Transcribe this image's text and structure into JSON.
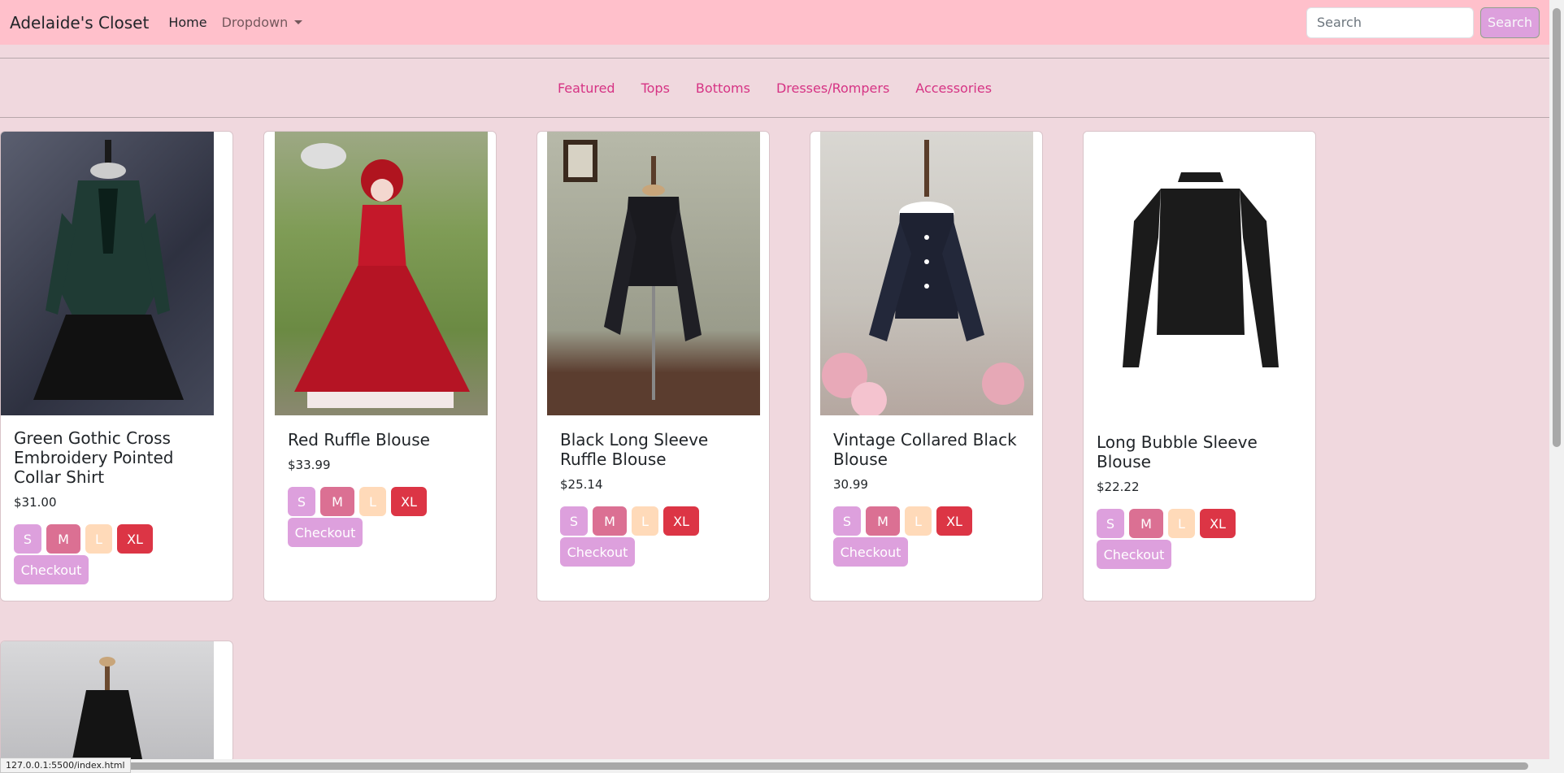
{
  "navbar": {
    "brand": "Adelaide's Closet",
    "home": "Home",
    "dropdown": "Dropdown",
    "search_placeholder": "Search",
    "search_button": "Search"
  },
  "categories": [
    "Featured",
    "Tops",
    "Bottoms",
    "Dresses/Rompers",
    "Accessories"
  ],
  "products": [
    {
      "title": "Green Gothic Cross Embroidery Pointed Collar Shirt",
      "price": "$31.00"
    },
    {
      "title": "Red Ruffle Blouse",
      "price": "$33.99"
    },
    {
      "title": "Black Long Sleeve Ruffle Blouse",
      "price": "$25.14"
    },
    {
      "title": "Vintage Collared Black Blouse",
      "price": "30.99"
    },
    {
      "title": "Long Bubble Sleeve Blouse",
      "price": "$22.22"
    }
  ],
  "sizes": {
    "s": "S",
    "m": "M",
    "l": "L",
    "xl": "XL"
  },
  "checkout_label": "Checkout",
  "status_url": "127.0.0.1:5500/index.html",
  "colors": {
    "navbar_bg": "#ffc0cb",
    "page_bg": "#f0d8de",
    "accent_link": "#d63384",
    "size_s": "#dda0dd",
    "size_m": "#db7093",
    "size_l": "#ffdab9",
    "size_xl": "#dc3545"
  }
}
